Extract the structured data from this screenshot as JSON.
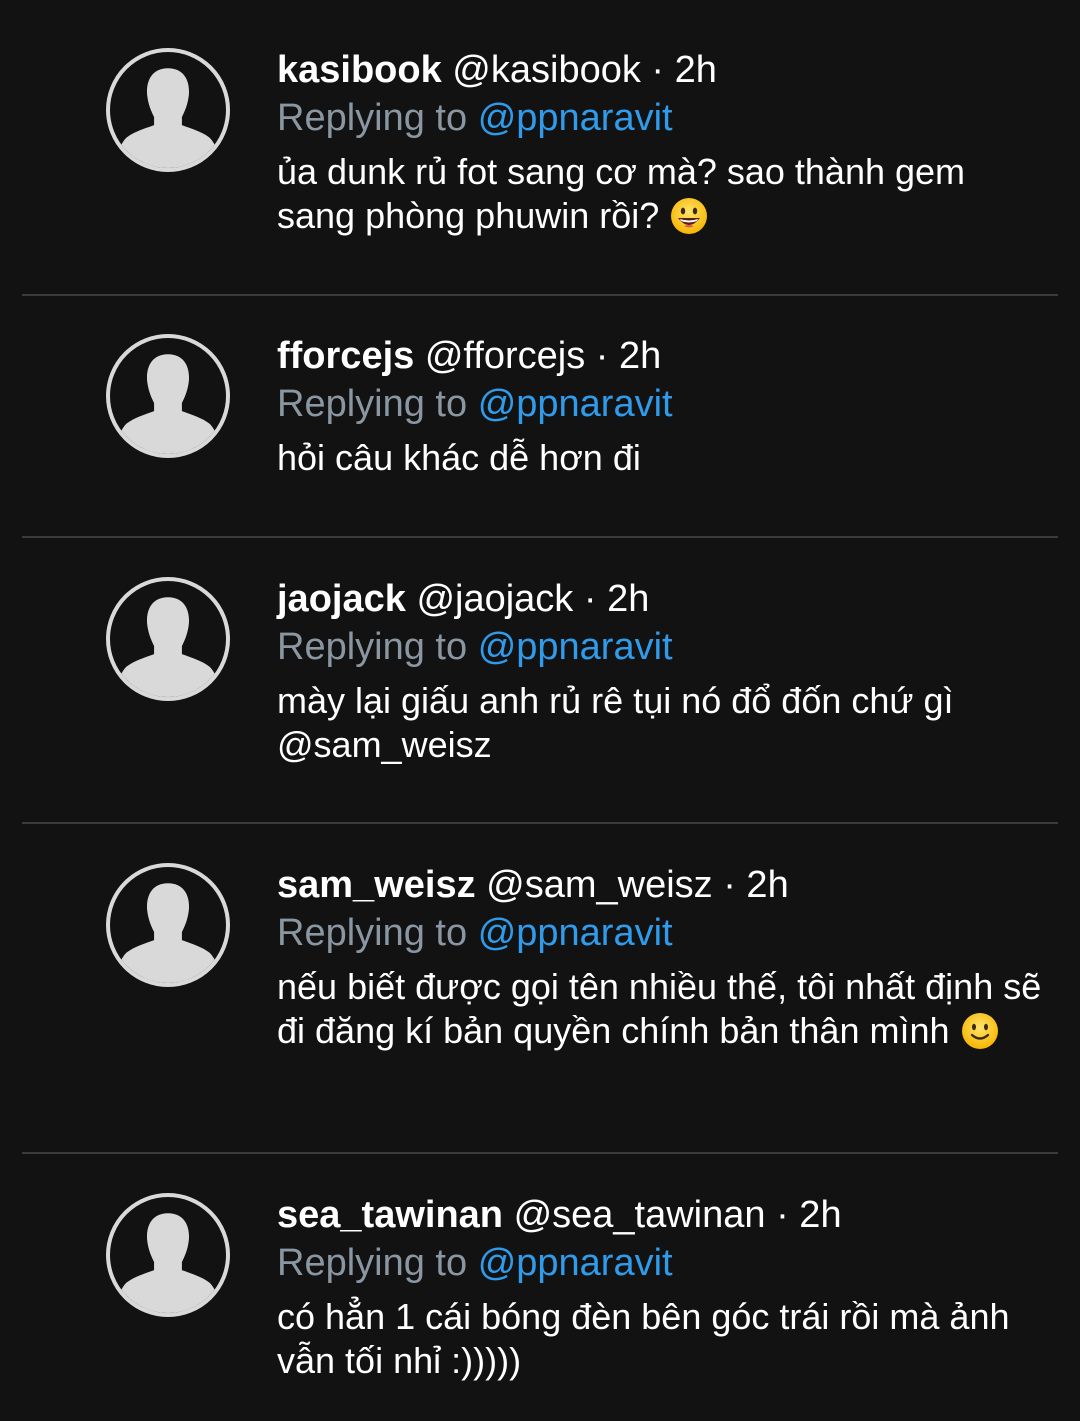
{
  "replies": [
    {
      "name": "kasibook",
      "handle": "@kasibook",
      "time": "· 2h",
      "replying_prefix": "Replying to",
      "replying_to": "@ppnaravit",
      "text": "ủa dunk rủ fot sang cơ mà? sao thành gem sang phòng phuwin rồi?",
      "emoji": "grinning-face-emoji"
    },
    {
      "name": "fforcejs",
      "handle": "@fforcejs",
      "time": "· 2h",
      "replying_prefix": "Replying to",
      "replying_to": "@ppnaravit",
      "text": "hỏi câu khác dễ hơn đi"
    },
    {
      "name": "jaojack",
      "handle": "@jaojack",
      "time": "· 2h",
      "replying_prefix": "Replying to",
      "replying_to": "@ppnaravit",
      "text": "mày lại giấu anh rủ rê tụi nó đổ đốn chứ gì @sam_weisz"
    },
    {
      "name": "sam_weisz",
      "handle": "@sam_weisz",
      "time": "· 2h",
      "replying_prefix": "Replying to",
      "replying_to": "@ppnaravit",
      "text": "nếu biết được gọi tên nhiều thế, tôi nhất định sẽ đi đăng kí bản quyền chính bản thân mình",
      "emoji": "slightly-smiling-face-emoji"
    },
    {
      "name": "sea_tawinan",
      "handle": "@sea_tawinan",
      "time": "· 2h",
      "replying_prefix": "Replying to",
      "replying_to": "@ppnaravit",
      "text": "có hẳn 1 cái bóng đèn bên góc trái rồi mà ảnh vẫn tối nhỉ :)))))"
    }
  ],
  "colors": {
    "background": "#121212",
    "mention": "#2f9bea",
    "secondary_text": "#8a97a3",
    "divider": "#3a3a3a"
  }
}
